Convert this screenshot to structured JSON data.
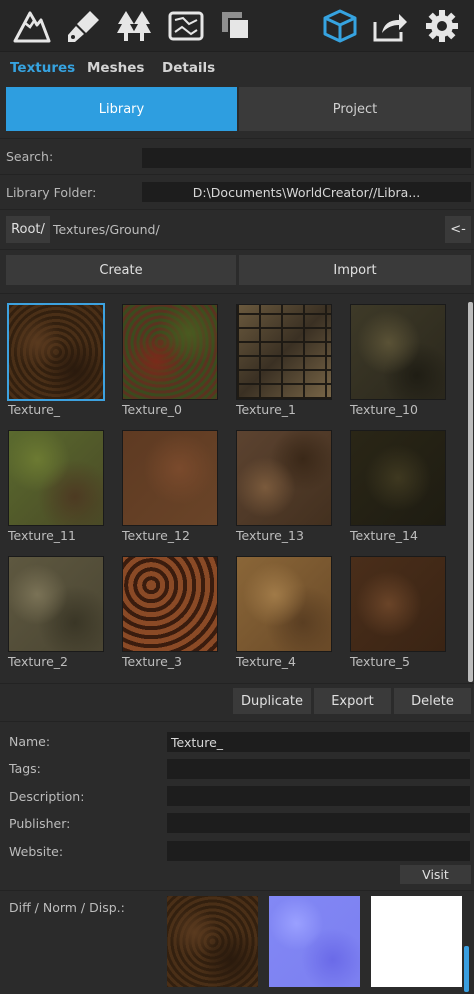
{
  "toolbar": {
    "icons": [
      "mountain-icon",
      "brush-icon",
      "trees-icon",
      "map-icon",
      "layers-icon",
      "box-icon",
      "share-icon",
      "gear-icon"
    ],
    "active_icon": "box-icon",
    "accent": "#36a3e0"
  },
  "tabs": [
    {
      "label": "Textures",
      "active": true
    },
    {
      "label": "Meshes",
      "active": false
    },
    {
      "label": "Details",
      "active": false
    }
  ],
  "segments": {
    "library": "Library",
    "project": "Project",
    "active": "library"
  },
  "search": {
    "label": "Search:",
    "value": ""
  },
  "library_folder": {
    "label": "Library Folder:",
    "value": "D:\\Documents\\WorldCreator//Libra..."
  },
  "path": {
    "root": "Root/",
    "current": "Textures/Ground/",
    "back": "<-"
  },
  "actions": {
    "create": "Create",
    "import": "Import"
  },
  "textures": [
    {
      "name": "Texture_",
      "selected": true
    },
    {
      "name": "Texture_0"
    },
    {
      "name": "Texture_1"
    },
    {
      "name": "Texture_10"
    },
    {
      "name": "Texture_11"
    },
    {
      "name": "Texture_12"
    },
    {
      "name": "Texture_13"
    },
    {
      "name": "Texture_14"
    },
    {
      "name": "Texture_2"
    },
    {
      "name": "Texture_3"
    },
    {
      "name": "Texture_4"
    },
    {
      "name": "Texture_5"
    }
  ],
  "item_actions": {
    "duplicate": "Duplicate",
    "export": "Export",
    "delete": "Delete"
  },
  "details": {
    "name_label": "Name:",
    "name_value": "Texture_",
    "tags_label": "Tags:",
    "tags_value": "",
    "description_label": "Description:",
    "description_value": "",
    "publisher_label": "Publisher:",
    "publisher_value": "",
    "website_label": "Website:",
    "website_value": "",
    "visit": "Visit",
    "maps_label": "Diff / Norm / Disp.:"
  }
}
